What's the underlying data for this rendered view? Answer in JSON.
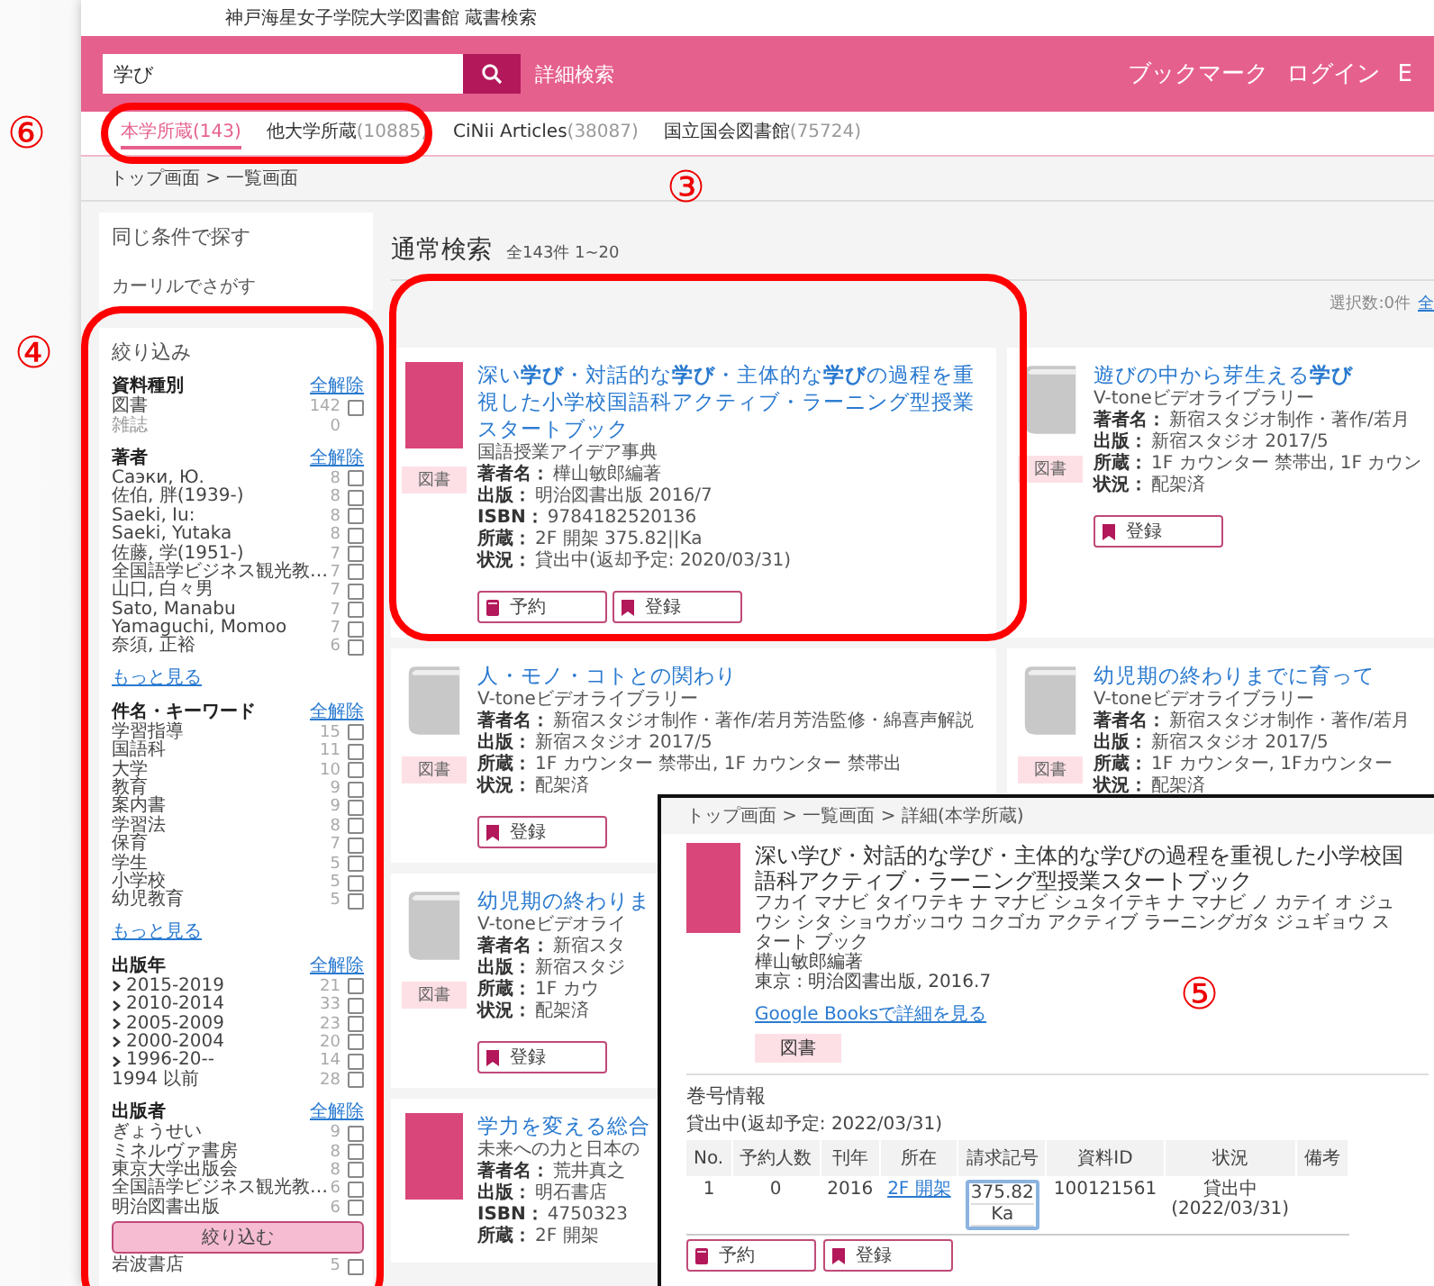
{
  "site_title": "神戸海星女子学院大学図書館 蔵書検索",
  "header": {
    "search_value": "学び",
    "advanced_link": "詳細検索",
    "nav": [
      "ブックマーク",
      "ログイン",
      "E"
    ]
  },
  "tabs": [
    {
      "label": "本学所蔵",
      "count": "(143)",
      "selected": true
    },
    {
      "label": "他大学所蔵",
      "count": "(10885)",
      "selected": false
    },
    {
      "label": "CiNii Articles",
      "count": "(38087)",
      "selected": false
    },
    {
      "label": "国立国会図書館",
      "count": "(75724)",
      "selected": false
    }
  ],
  "breadcrumb": "トップ画面 > 一覧画面",
  "sidebar": {
    "same_title": "同じ条件で探す",
    "calil_link": "カーリルでさがす",
    "refine_title": "絞り込み",
    "apply_button": "絞り込む",
    "groups": [
      {
        "title": "資料種別",
        "clear": "全解除",
        "items": [
          {
            "label": "図書",
            "count": "142",
            "disabled": false,
            "checked": false
          },
          {
            "label": "雑誌",
            "count": "0",
            "disabled": true
          }
        ]
      },
      {
        "title": "著者",
        "clear": "全解除",
        "more": "もっと見る",
        "items": [
          {
            "label": "Саэки, Ю.",
            "count": "8",
            "disabled": false,
            "checked": false
          },
          {
            "label": "佐伯, 胖(1939-)",
            "count": "8",
            "disabled": false,
            "checked": false
          },
          {
            "label": "Saeki, Iu:",
            "count": "8",
            "disabled": false,
            "checked": false
          },
          {
            "label": "Saeki, Yutaka",
            "count": "8",
            "disabled": false,
            "checked": false
          },
          {
            "label": "佐藤, 学(1951-)",
            "count": "7",
            "disabled": false,
            "checked": false
          },
          {
            "label": "全国語学ビジネス観光教…",
            "count": "7",
            "disabled": false,
            "checked": false
          },
          {
            "label": "山口, 白々男",
            "count": "7",
            "disabled": false,
            "checked": false
          },
          {
            "label": "Sato, Manabu",
            "count": "7",
            "disabled": false,
            "checked": false
          },
          {
            "label": "Yamaguchi, Momoo",
            "count": "7",
            "disabled": false,
            "checked": false
          },
          {
            "label": "奈須, 正裕",
            "count": "6",
            "disabled": false,
            "checked": false
          }
        ]
      },
      {
        "title": "件名・キーワード",
        "clear": "全解除",
        "more": "もっと見る",
        "items": [
          {
            "label": "学習指導",
            "count": "15",
            "disabled": false,
            "checked": false
          },
          {
            "label": "国語科",
            "count": "11",
            "disabled": false,
            "checked": false
          },
          {
            "label": "大学",
            "count": "10",
            "disabled": false,
            "checked": false
          },
          {
            "label": "教育",
            "count": "9",
            "disabled": false,
            "checked": false
          },
          {
            "label": "案内書",
            "count": "9",
            "disabled": false,
            "checked": false
          },
          {
            "label": "学習法",
            "count": "8",
            "disabled": false,
            "checked": false
          },
          {
            "label": "保育",
            "count": "7",
            "disabled": false,
            "checked": false
          },
          {
            "label": "学生",
            "count": "5",
            "disabled": false,
            "checked": false
          },
          {
            "label": "小学校",
            "count": "5",
            "disabled": false,
            "checked": false
          },
          {
            "label": "幼児教育",
            "count": "5",
            "disabled": false,
            "checked": false
          }
        ]
      },
      {
        "title": "出版年",
        "clear": "全解除",
        "items": [
          {
            "label": "2015-2019",
            "count": "21",
            "disabled": false,
            "expandable": true,
            "checked": false
          },
          {
            "label": "2010-2014",
            "count": "33",
            "disabled": false,
            "expandable": true,
            "checked": false
          },
          {
            "label": "2005-2009",
            "count": "23",
            "disabled": false,
            "expandable": true,
            "checked": false
          },
          {
            "label": "2000-2004",
            "count": "20",
            "disabled": false,
            "expandable": true,
            "checked": false
          },
          {
            "label": "1996-20--",
            "count": "14",
            "disabled": false,
            "expandable": true,
            "checked": false
          },
          {
            "label": "1994 以前",
            "count": "28",
            "disabled": false,
            "expandable": false,
            "checked": false
          }
        ]
      },
      {
        "title": "出版者",
        "clear": "全解除",
        "items": [
          {
            "label": "ぎょうせい",
            "count": "9",
            "disabled": false,
            "checked": false
          },
          {
            "label": "ミネルヴァ書房",
            "count": "8",
            "disabled": false,
            "checked": false
          },
          {
            "label": "東京大学出版会",
            "count": "8",
            "disabled": false,
            "checked": false
          },
          {
            "label": "全国語学ビジネス観光教…",
            "count": "6",
            "disabled": false,
            "checked": false
          },
          {
            "label": "明治図書出版",
            "count": "6",
            "disabled": false,
            "checked": false
          }
        ],
        "after_button": [
          {
            "label": "岩波書店",
            "count": "5",
            "disabled": false,
            "checked": false
          }
        ]
      }
    ]
  },
  "results": {
    "title": "通常検索",
    "summary": "全143件 1~20",
    "selected_count": "選択数:0件",
    "select_all": "全",
    "rows": [
      {
        "cards": [
          {
            "kind": "photo",
            "title": "深い**学び**・対話的な**学び**・主体的な**学び**の過程を重視した小学校国語科アクティブ・ラーニング型授業スタートブック",
            "subtitle": "国語授業アイデア事典",
            "type": "図書",
            "meta": [
              {
                "label": "著者名：",
                "value": "樺山敏郎編著"
              },
              {
                "label": "出版：",
                "value": "明治図書出版 2016/7"
              },
              {
                "label": "ISBN：",
                "value": "9784182520136"
              },
              {
                "label": "所蔵：",
                "value": "2F 開架 375.82||Ka"
              },
              {
                "label": "状況：",
                "value": "貸出中(返却予定: 2020/03/31)"
              }
            ],
            "buttons": [
              {
                "kind": "reserve",
                "label": "予約"
              },
              {
                "kind": "register",
                "label": "登録"
              }
            ]
          },
          {
            "kind": "generic",
            "title": "遊びの中から芽生える**学び**",
            "subtitle": "V-toneビデオライブラリー",
            "type": "図書",
            "meta": [
              {
                "label": "著者名：",
                "value": "新宿スタジオ制作・著作/若月"
              },
              {
                "label": "出版：",
                "value": "新宿スタジオ 2017/5"
              },
              {
                "label": "所蔵：",
                "value": "1F カウンター 禁帯出, 1F カウン"
              },
              {
                "label": "状況：",
                "value": "配架済"
              }
            ],
            "buttons": [
              {
                "kind": "register",
                "label": "登録"
              }
            ]
          }
        ]
      },
      {
        "cards": [
          {
            "kind": "generic",
            "title": "人・モノ・コトとの関わり",
            "subtitle": "V-toneビデオライブラリー",
            "type": "図書",
            "meta": [
              {
                "label": "著者名：",
                "value": "新宿スタジオ制作・著作/若月芳浩監修・綿喜声解説"
              },
              {
                "label": "出版：",
                "value": "新宿スタジオ 2017/5"
              },
              {
                "label": "所蔵：",
                "value": "1F カウンター 禁帯出, 1F カウンター 禁帯出"
              },
              {
                "label": "状況：",
                "value": "配架済"
              }
            ],
            "buttons": [
              {
                "kind": "register",
                "label": "登録"
              }
            ]
          },
          {
            "kind": "generic",
            "title": "幼児期の終わりまでに育って",
            "subtitle": "V-toneビデオライブラリー",
            "type": "図書",
            "meta": [
              {
                "label": "著者名：",
                "value": "新宿スタジオ制作・著作/若月"
              },
              {
                "label": "出版：",
                "value": "新宿スタジオ 2017/5"
              },
              {
                "label": "所蔵：",
                "value": "1F カウンター, 1Fカウンター"
              },
              {
                "label": "状況：",
                "value": "配架済"
              }
            ]
          }
        ]
      },
      {
        "cards": [
          {
            "kind": "generic",
            "title": "幼児期の終わりま",
            "subtitle": "V-toneビデオライ",
            "type": "図書",
            "meta": [
              {
                "label": "著者名：",
                "value": "新宿スタ"
              },
              {
                "label": "出版：",
                "value": "新宿スタジ"
              },
              {
                "label": "所蔵：",
                "value": "1F カウ"
              },
              {
                "label": "状況：",
                "value": "配架済"
              }
            ],
            "buttons": [
              {
                "kind": "register",
                "label": "登録"
              }
            ]
          }
        ]
      },
      {
        "cards": [
          {
            "kind": "photo",
            "title": "学力を変える総合",
            "subtitle": "未来への力と日本の",
            "meta": [
              {
                "label": "著者名：",
                "value": "荒井真之"
              },
              {
                "label": "出版：",
                "value": "明石書店"
              },
              {
                "label": "ISBN：",
                "value": "4750323"
              },
              {
                "label": "所蔵：",
                "value": "2F 開架"
              }
            ]
          }
        ]
      }
    ]
  },
  "detail": {
    "breadcrumb": "トップ画面 > 一覧画面 > 詳細(本学所蔵)",
    "title": "深い学び・対話的な学び・主体的な学びの過程を重視した小学校国語科アクティブ・ラーニング型授業スタートブック",
    "reading": "フカイ マナビ タイワテキ ナ マナビ シュタイテキ ナ マナビ ノ カテイ オ ジュウシ シタ ショウガッコウ コクゴカ アクティブ ラーニングガタ ジュギョウ スタート ブック",
    "author": "樺山敏郎編著",
    "publication": "東京 : 明治図書出版, 2016.7",
    "google_link": "Google Booksで詳細を見る",
    "type": "図書",
    "section": "巻号情報",
    "status": "貸出中(返却予定: 2022/03/31)",
    "columns": [
      "No.",
      "予約人数",
      "刊年",
      "所在",
      "請求記号",
      "資料ID",
      "状況",
      "備考"
    ],
    "row": {
      "no": "1",
      "reservations": "0",
      "year": "2016",
      "location": "2F 開架",
      "call_number": [
        "375.82",
        "Ka"
      ],
      "item_id": "100121561",
      "status": [
        "貸出中",
        "(2022/03/31)"
      ]
    },
    "buttons": [
      {
        "kind": "reserve",
        "label": "予約"
      },
      {
        "kind": "register",
        "label": "登録"
      }
    ]
  },
  "annotations": [
    {
      "label": "⑥"
    },
    {
      "label": "③"
    },
    {
      "label": "④"
    },
    {
      "label": "⑤"
    }
  ]
}
